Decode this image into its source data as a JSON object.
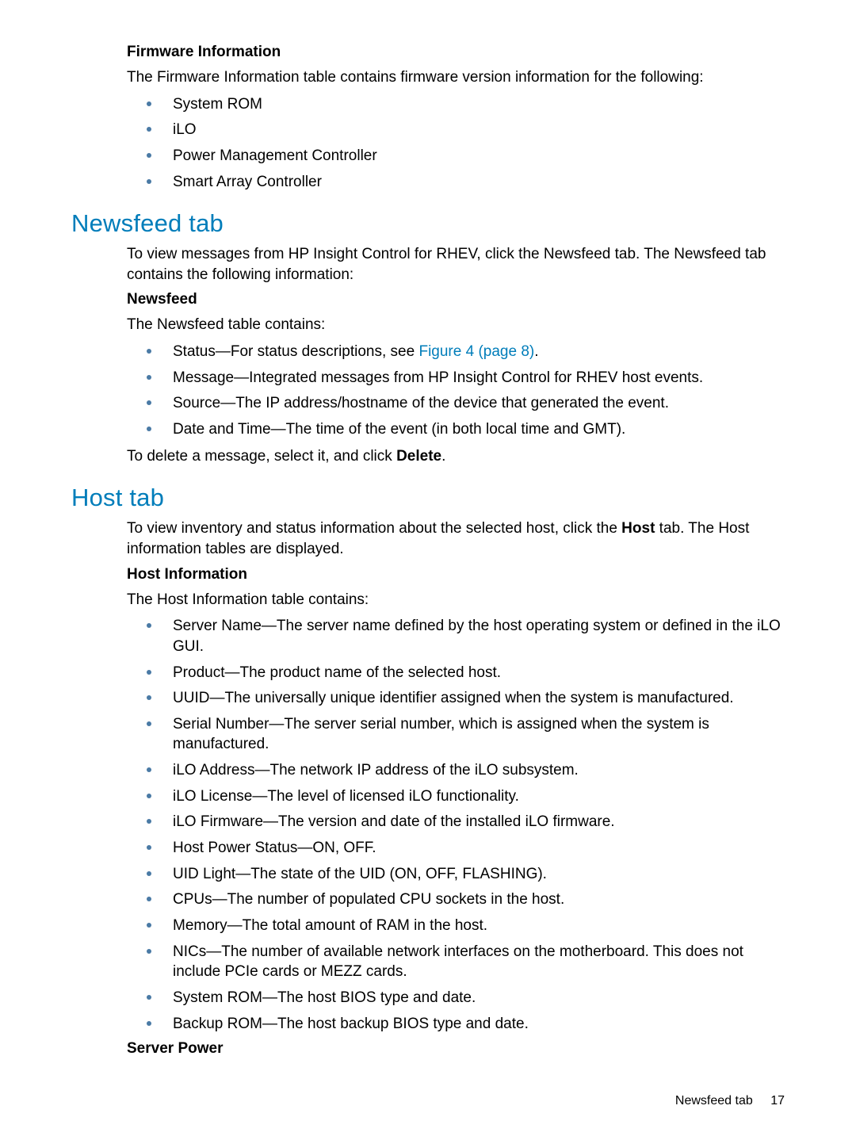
{
  "firmware": {
    "heading": "Firmware Information",
    "intro": "The Firmware Information table contains firmware version information for the following:",
    "items": [
      "System ROM",
      "iLO",
      "Power Management Controller",
      "Smart Array Controller"
    ]
  },
  "newsfeed": {
    "title": "Newsfeed tab",
    "intro": "To view messages from HP Insight Control for RHEV, click the Newsfeed tab. The Newsfeed tab contains the following information:",
    "heading": "Newsfeed",
    "table_intro": "The Newsfeed table contains:",
    "items_pre": [
      "Status—For status descriptions, see "
    ],
    "figure_link": "Figure 4 (page 8)",
    "items_pre_suffix": ".",
    "items_rest": [
      "Message—Integrated messages from HP Insight Control for RHEV host events.",
      "Source—The IP address/hostname of the device that generated the event.",
      "Date and Time—The time of the event (in both local time and GMT)."
    ],
    "delete_pre": "To delete a message, select it, and click ",
    "delete_bold": "Delete",
    "delete_post": "."
  },
  "host": {
    "title": "Host tab",
    "intro_pre": "To view inventory and status information about the selected host, click the ",
    "intro_bold": "Host",
    "intro_post": " tab. The Host information tables are displayed.",
    "heading": "Host Information",
    "table_intro": "The Host Information table contains:",
    "items": [
      "Server Name—The server name defined by the host operating system or defined in the iLO GUI.",
      "Product—The product name of the selected host.",
      "UUID—The universally unique identifier assigned when the system is manufactured.",
      "Serial Number—The server serial number, which is assigned when the system is manufactured.",
      "iLO Address—The network IP address of the iLO subsystem.",
      "iLO License—The level of licensed iLO functionality.",
      "iLO Firmware—The version and date of the installed iLO firmware.",
      "Host Power Status—ON, OFF.",
      "UID Light—The state of the UID (ON, OFF, FLASHING).",
      "CPUs—The number of populated CPU sockets in the host.",
      "Memory—The total amount of RAM in the host.",
      "NICs—The number of available network interfaces on the motherboard. This does not include PCIe cards or MEZZ cards.",
      "System ROM—The host BIOS type and date.",
      "Backup ROM—The host backup BIOS type and date."
    ],
    "server_power_heading": "Server Power"
  },
  "footer": {
    "label": "Newsfeed tab",
    "page": "17"
  }
}
